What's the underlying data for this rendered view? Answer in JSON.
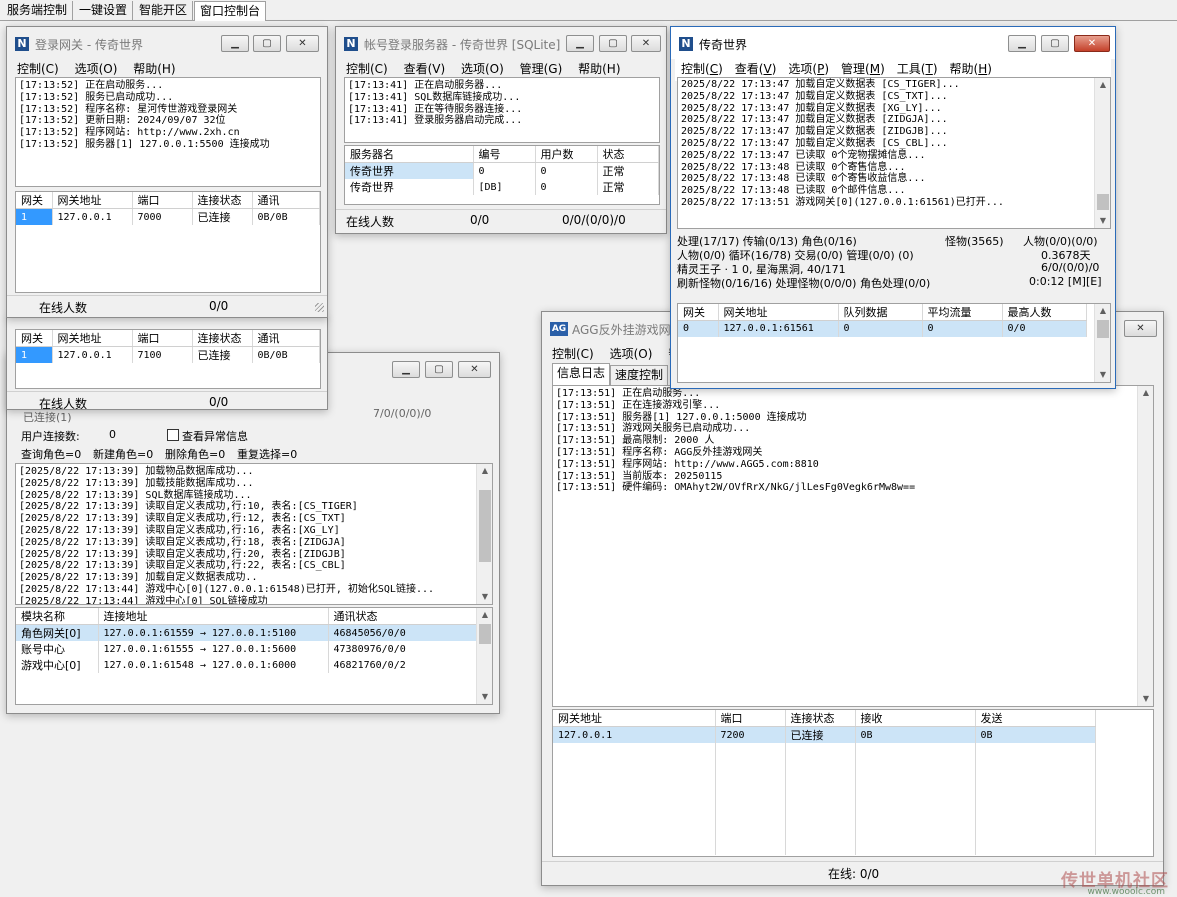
{
  "topbar": {
    "tabs": [
      "服务端控制",
      "一键设置",
      "智能开区",
      "窗口控制台"
    ]
  },
  "gw": {
    "title": "登录网关 - 传奇世界",
    "menu": [
      "控制(C)",
      "选项(O)",
      "帮助(H)"
    ],
    "log": [
      "[17:13:52] 正在启动服务...",
      "[17:13:52] 服务已启动成功...",
      "[17:13:52] 程序名称: 星河传世游戏登录网关",
      "[17:13:52] 更新日期: 2024/09/07 32位",
      "[17:13:52] 程序网站: http://www.2xh.cn",
      "[17:13:52] 服务器[1] 127.0.0.1:5500 连接成功"
    ],
    "headers": [
      "网关",
      "网关地址",
      "端口",
      "连接状态",
      "通讯"
    ],
    "row": [
      "1",
      "127.0.0.1",
      "7000",
      "已连接",
      "0B/0B"
    ],
    "status_label": "在线人数",
    "status_value": "0/0"
  },
  "gw2": {
    "headers": [
      "网关",
      "网关地址",
      "端口",
      "连接状态",
      "通讯"
    ],
    "row": [
      "1",
      "127.0.0.1",
      "7100",
      "已连接",
      "0B/0B"
    ],
    "status_label": "在线人数",
    "status_value": "0/0"
  },
  "acct": {
    "title": "帐号登录服务器 - 传奇世界 [SQLite]",
    "menu": [
      "控制(C)",
      "查看(V)",
      "选项(O)",
      "管理(G)",
      "帮助(H)"
    ],
    "log": [
      "[17:13:41] 正在启动服务器...",
      "[17:13:41] SQL数据库链接成功...",
      "[17:13:41] 正在等待服务器连接...",
      "[17:13:41] 登录服务器启动完成..."
    ],
    "headers": [
      "服务器名",
      "编号",
      "用户数",
      "状态"
    ],
    "rows": [
      [
        "传奇世界",
        "0",
        "0",
        "正常"
      ],
      [
        "传奇世界",
        "[DB]",
        "0",
        "正常"
      ]
    ],
    "status_label": "在线人数",
    "status_v1": "0/0",
    "status_v2": "0/0/(0/0)/0"
  },
  "db": {
    "connected": "已连接(1)",
    "count_right": "7/0/(0/0)/0",
    "user_conn_label": "用户连接数:",
    "user_conn_value": "0",
    "check_label": "查看异常信息",
    "queries": [
      "查询角色=0",
      "新建角色=0",
      "删除角色=0",
      "重复选择=0"
    ],
    "log": [
      "[2025/8/22 17:13:39] 加载物品数据库成功...",
      "[2025/8/22 17:13:39] 加载技能数据库成功...",
      "[2025/8/22 17:13:39] SQL数据库链接成功...",
      "[2025/8/22 17:13:39] 读取自定义表成功,行:10, 表名:[CS_TIGER]",
      "[2025/8/22 17:13:39] 读取自定义表成功,行:12, 表名:[CS_TXT]",
      "[2025/8/22 17:13:39] 读取自定义表成功,行:16, 表名:[XG_LY]",
      "[2025/8/22 17:13:39] 读取自定义表成功,行:18, 表名:[ZIDGJA]",
      "[2025/8/22 17:13:39] 读取自定义表成功,行:20, 表名:[ZIDGJB]",
      "[2025/8/22 17:13:39] 读取自定义表成功,行:22, 表名:[CS_CBL]",
      "[2025/8/22 17:13:39] 加载自定义数据表成功..",
      "[2025/8/22 17:13:44] 游戏中心[0](127.0.0.1:61548)已打开, 初始化SQL链接...",
      "[2025/8/22 17:13:44] 游戏中心[0] SQL链接成功"
    ],
    "headers": [
      "模块名称",
      "连接地址",
      "通讯状态"
    ],
    "rows": [
      [
        "角色网关[0]",
        "127.0.0.1:61559 → 127.0.0.1:5100",
        "46845056/0/0"
      ],
      [
        "账号中心",
        "127.0.0.1:61555 → 127.0.0.1:5600",
        "47380976/0/0"
      ],
      [
        "游戏中心[0]",
        "127.0.0.1:61548 → 127.0.0.1:6000",
        "46821760/0/2"
      ]
    ]
  },
  "agg": {
    "title": "AGG反外挂游戏网关",
    "menu": [
      "控制(C)",
      "选项(O)",
      "帮"
    ],
    "tabs": [
      "信息日志",
      "速度控制"
    ],
    "log": [
      "[17:13:51] 正在启动服务...",
      "[17:13:51] 正在连接游戏引擎...",
      "[17:13:51] 服务器[1] 127.0.0.1:5000 连接成功",
      "[17:13:51] 游戏网关服务已启动成功...",
      "[17:13:51] 最高限制: 2000 人",
      "[17:13:51] 程序名称: AGG反外挂游戏网关",
      "[17:13:51] 程序网站: http://www.AGG5.com:8810",
      "[17:13:51] 当前版本: 20250115",
      "[17:13:51] 硬件编码: OMAhyt2W/OVfRrX/NkG/jlLesFg0Vegk6rMw8w=="
    ],
    "headers": [
      "网关地址",
      "端口",
      "连接状态",
      "接收",
      "发送"
    ],
    "row": [
      "127.0.0.1",
      "7200",
      "已连接",
      "0B",
      "0B"
    ],
    "status": "在线: 0/0"
  },
  "m2": {
    "title": "传奇世界",
    "menu": [
      {
        "t": "控制",
        "k": "C"
      },
      {
        "t": "查看",
        "k": "V"
      },
      {
        "t": "选项",
        "k": "P"
      },
      {
        "t": "管理",
        "k": "M"
      },
      {
        "t": "工具",
        "k": "T"
      },
      {
        "t": "帮助",
        "k": "H"
      }
    ],
    "log": [
      "2025/8/22 17:13:47 加载自定义数据表 [CS_TIGER]...",
      "2025/8/22 17:13:47 加载自定义数据表 [CS_TXT]...",
      "2025/8/22 17:13:47 加载自定义数据表 [XG_LY]...",
      "2025/8/22 17:13:47 加载自定义数据表 [ZIDGJA]...",
      "2025/8/22 17:13:47 加载自定义数据表 [ZIDGJB]...",
      "2025/8/22 17:13:47 加载自定义数据表 [CS_CBL]...",
      "2025/8/22 17:13:47 已读取 0个宠物摆摊信息...",
      "2025/8/22 17:13:48 已读取 0个寄售信息...",
      "2025/8/22 17:13:48 已读取 0个寄售收益信息...",
      "2025/8/22 17:13:48 已读取 0个邮件信息...",
      "2025/8/22 17:13:51 游戏网关[0](127.0.0.1:61561)已打开..."
    ],
    "stats": {
      "l1a": "处理(17/17) 传输(0/13) 角色(0/16)",
      "l1b": "怪物(3565)",
      "l1c": "人物(0/0)(0/0)",
      "l2a": "人物(0/0) 循环(16/78) 交易(0/0) 管理(0/0) (0)",
      "l2b": "0.3678天",
      "l3a": "精灵王子 · 1 0, 星海黑洞, 40/171",
      "l3b": "6/0/(0/0)/0",
      "l4a": "刷新怪物(0/16/16) 处理怪物(0/0/0) 角色处理(0/0)",
      "l4b": "0:0:12 [M][E]"
    },
    "headers": [
      "网关",
      "网关地址",
      "队列数据",
      "平均流量",
      "最高人数"
    ],
    "row": [
      "0",
      "127.0.0.1:61561",
      "0",
      "0",
      "0/0"
    ]
  },
  "watermark": {
    "text": "传世单机社区",
    "url": "www.wooolc.com"
  }
}
